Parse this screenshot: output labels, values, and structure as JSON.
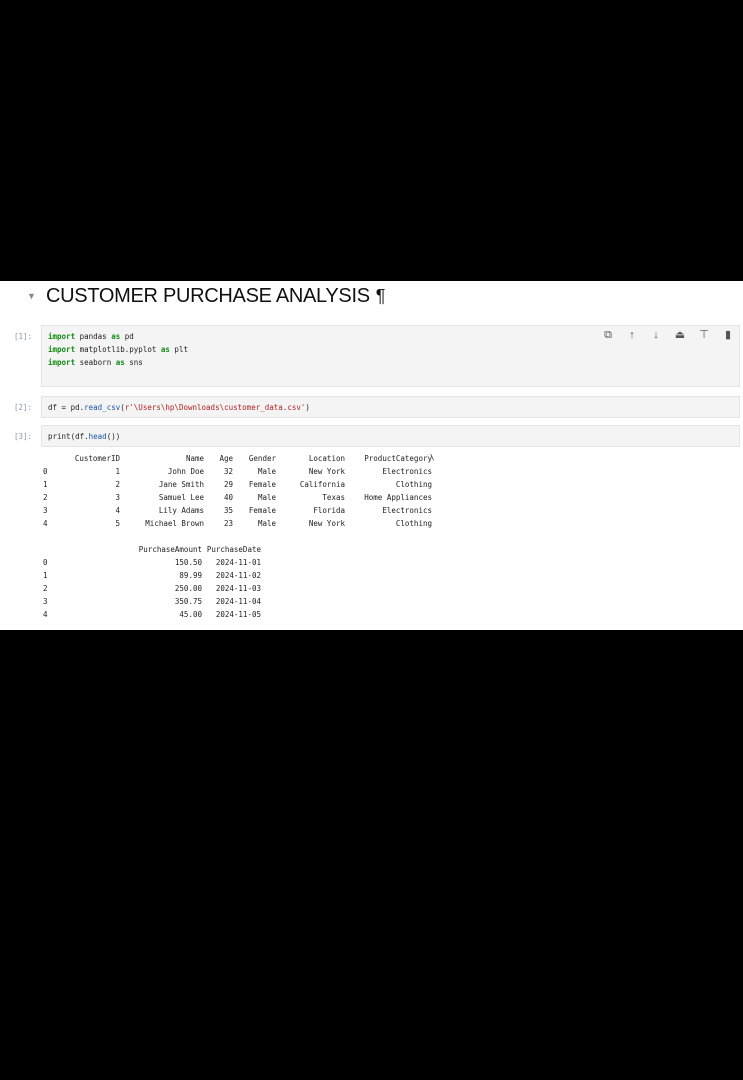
{
  "heading": {
    "title": "CUSTOMER PURCHASE ANALYSIS",
    "pilcrow": "¶"
  },
  "toolbar": [
    "copy-icon",
    "arrow-up-icon",
    "arrow-down-icon",
    "insert-above-icon",
    "insert-below-icon",
    "delete-icon"
  ],
  "cells": {
    "c1": {
      "prompt": "[1]:",
      "lines": [
        {
          "kw": "import",
          "rest1": " pandas ",
          "kw2": "as",
          "rest2": " pd"
        },
        {
          "kw": "import",
          "rest1": " matplotlib.pyplot ",
          "kw2": "as",
          "rest2": " plt"
        },
        {
          "kw": "import",
          "rest1": " seaborn ",
          "kw2": "as",
          "rest2": " sns"
        }
      ]
    },
    "c2": {
      "prompt": "[2]:",
      "pre": "df = pd.",
      "fn": "read_csv",
      "open": "(",
      "str": "r'\\Users\\hp\\Downloads\\customer_data.csv'",
      "close": ")"
    },
    "c3": {
      "prompt": "[3]:",
      "pre": "print(df.",
      "fn": "head",
      "close": "())"
    }
  },
  "output": {
    "continuation": "\\",
    "table1": {
      "columns": [
        "",
        "CustomerID",
        "Name",
        "Age",
        "Gender",
        "Location",
        "ProductCategory"
      ],
      "rows": [
        [
          "0",
          "1",
          "John Doe",
          "32",
          "Male",
          "New York",
          "Electronics"
        ],
        [
          "1",
          "2",
          "Jane Smith",
          "29",
          "Female",
          "California",
          "Clothing"
        ],
        [
          "2",
          "3",
          "Samuel Lee",
          "40",
          "Male",
          "Texas",
          "Home Appliances"
        ],
        [
          "3",
          "4",
          "Lily Adams",
          "35",
          "Female",
          "Florida",
          "Electronics"
        ],
        [
          "4",
          "5",
          "Michael Brown",
          "23",
          "Male",
          "New York",
          "Clothing"
        ]
      ]
    },
    "table2": {
      "columns": [
        "",
        "PurchaseAmount",
        "PurchaseDate"
      ],
      "rows": [
        [
          "0",
          "150.50",
          "2024-11-01"
        ],
        [
          "1",
          "89.99",
          "2024-11-02"
        ],
        [
          "2",
          "250.00",
          "2024-11-03"
        ],
        [
          "3",
          "350.75",
          "2024-11-04"
        ],
        [
          "4",
          "45.00",
          "2024-11-05"
        ]
      ]
    }
  }
}
